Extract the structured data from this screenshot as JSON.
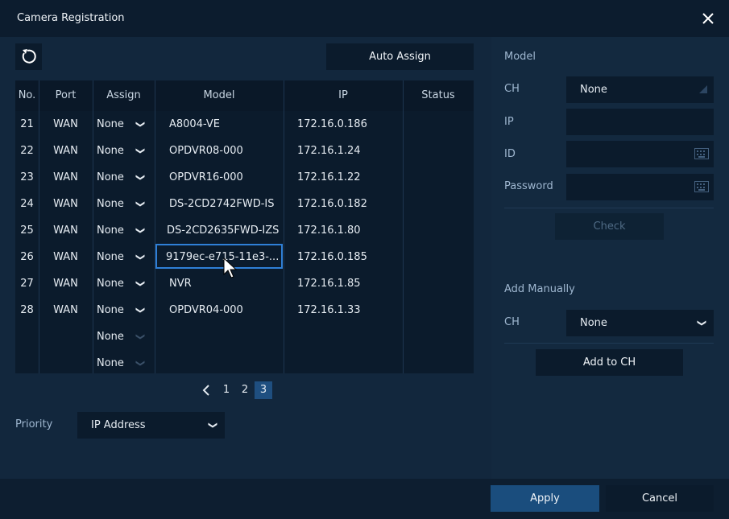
{
  "window": {
    "title": "Camera Registration"
  },
  "toolbar": {
    "auto_assign_label": "Auto Assign"
  },
  "table": {
    "headers": [
      "No.",
      "Port",
      "Assign",
      "Model",
      "IP",
      "Status"
    ],
    "rows": [
      {
        "no": "21",
        "port": "WAN",
        "assign": "None",
        "model": "A8004-VE",
        "ip": "172.16.0.186",
        "status": ""
      },
      {
        "no": "22",
        "port": "WAN",
        "assign": "None",
        "model": "OPDVR08-000",
        "ip": "172.16.1.24",
        "status": ""
      },
      {
        "no": "23",
        "port": "WAN",
        "assign": "None",
        "model": "OPDVR16-000",
        "ip": "172.16.1.22",
        "status": ""
      },
      {
        "no": "24",
        "port": "WAN",
        "assign": "None",
        "model": "DS-2CD2742FWD-IS",
        "ip": "172.16.0.182",
        "status": ""
      },
      {
        "no": "25",
        "port": "WAN",
        "assign": "None",
        "model": "DS-2CD2635FWD-IZS",
        "ip": "172.16.1.80",
        "status": ""
      },
      {
        "no": "26",
        "port": "WAN",
        "assign": "None",
        "model": "9179ec-e715-11e3-...",
        "ip": "172.16.0.185",
        "status": ""
      },
      {
        "no": "27",
        "port": "WAN",
        "assign": "None",
        "model": "NVR",
        "ip": "172.16.1.85",
        "status": ""
      },
      {
        "no": "28",
        "port": "WAN",
        "assign": "None",
        "model": "OPDVR04-000",
        "ip": "172.16.1.33",
        "status": ""
      },
      {
        "no": "",
        "port": "",
        "assign": "None",
        "model": "",
        "ip": "",
        "status": ""
      },
      {
        "no": "",
        "port": "",
        "assign": "None",
        "model": "",
        "ip": "",
        "status": ""
      }
    ]
  },
  "pagination": {
    "pages": [
      "1",
      "2",
      "3"
    ],
    "current": "3"
  },
  "priority": {
    "label": "Priority",
    "value": "IP Address"
  },
  "model_panel": {
    "section_label": "Model",
    "ch_label": "CH",
    "ch_value": "None",
    "ip_label": "IP",
    "ip_value": "",
    "id_label": "ID",
    "id_value": "",
    "password_label": "Password",
    "password_value": "",
    "check_label": "Check"
  },
  "add_manually": {
    "section_label": "Add Manually",
    "ch_label": "CH",
    "ch_value": "None",
    "add_label": "Add to CH"
  },
  "footer": {
    "apply_label": "Apply",
    "cancel_label": "Cancel"
  },
  "colors": {
    "accent": "#1a4d7d",
    "selection_border": "#2f7fd6",
    "panel_bg": "#0b1b2c",
    "window_bg": "#12273d"
  }
}
